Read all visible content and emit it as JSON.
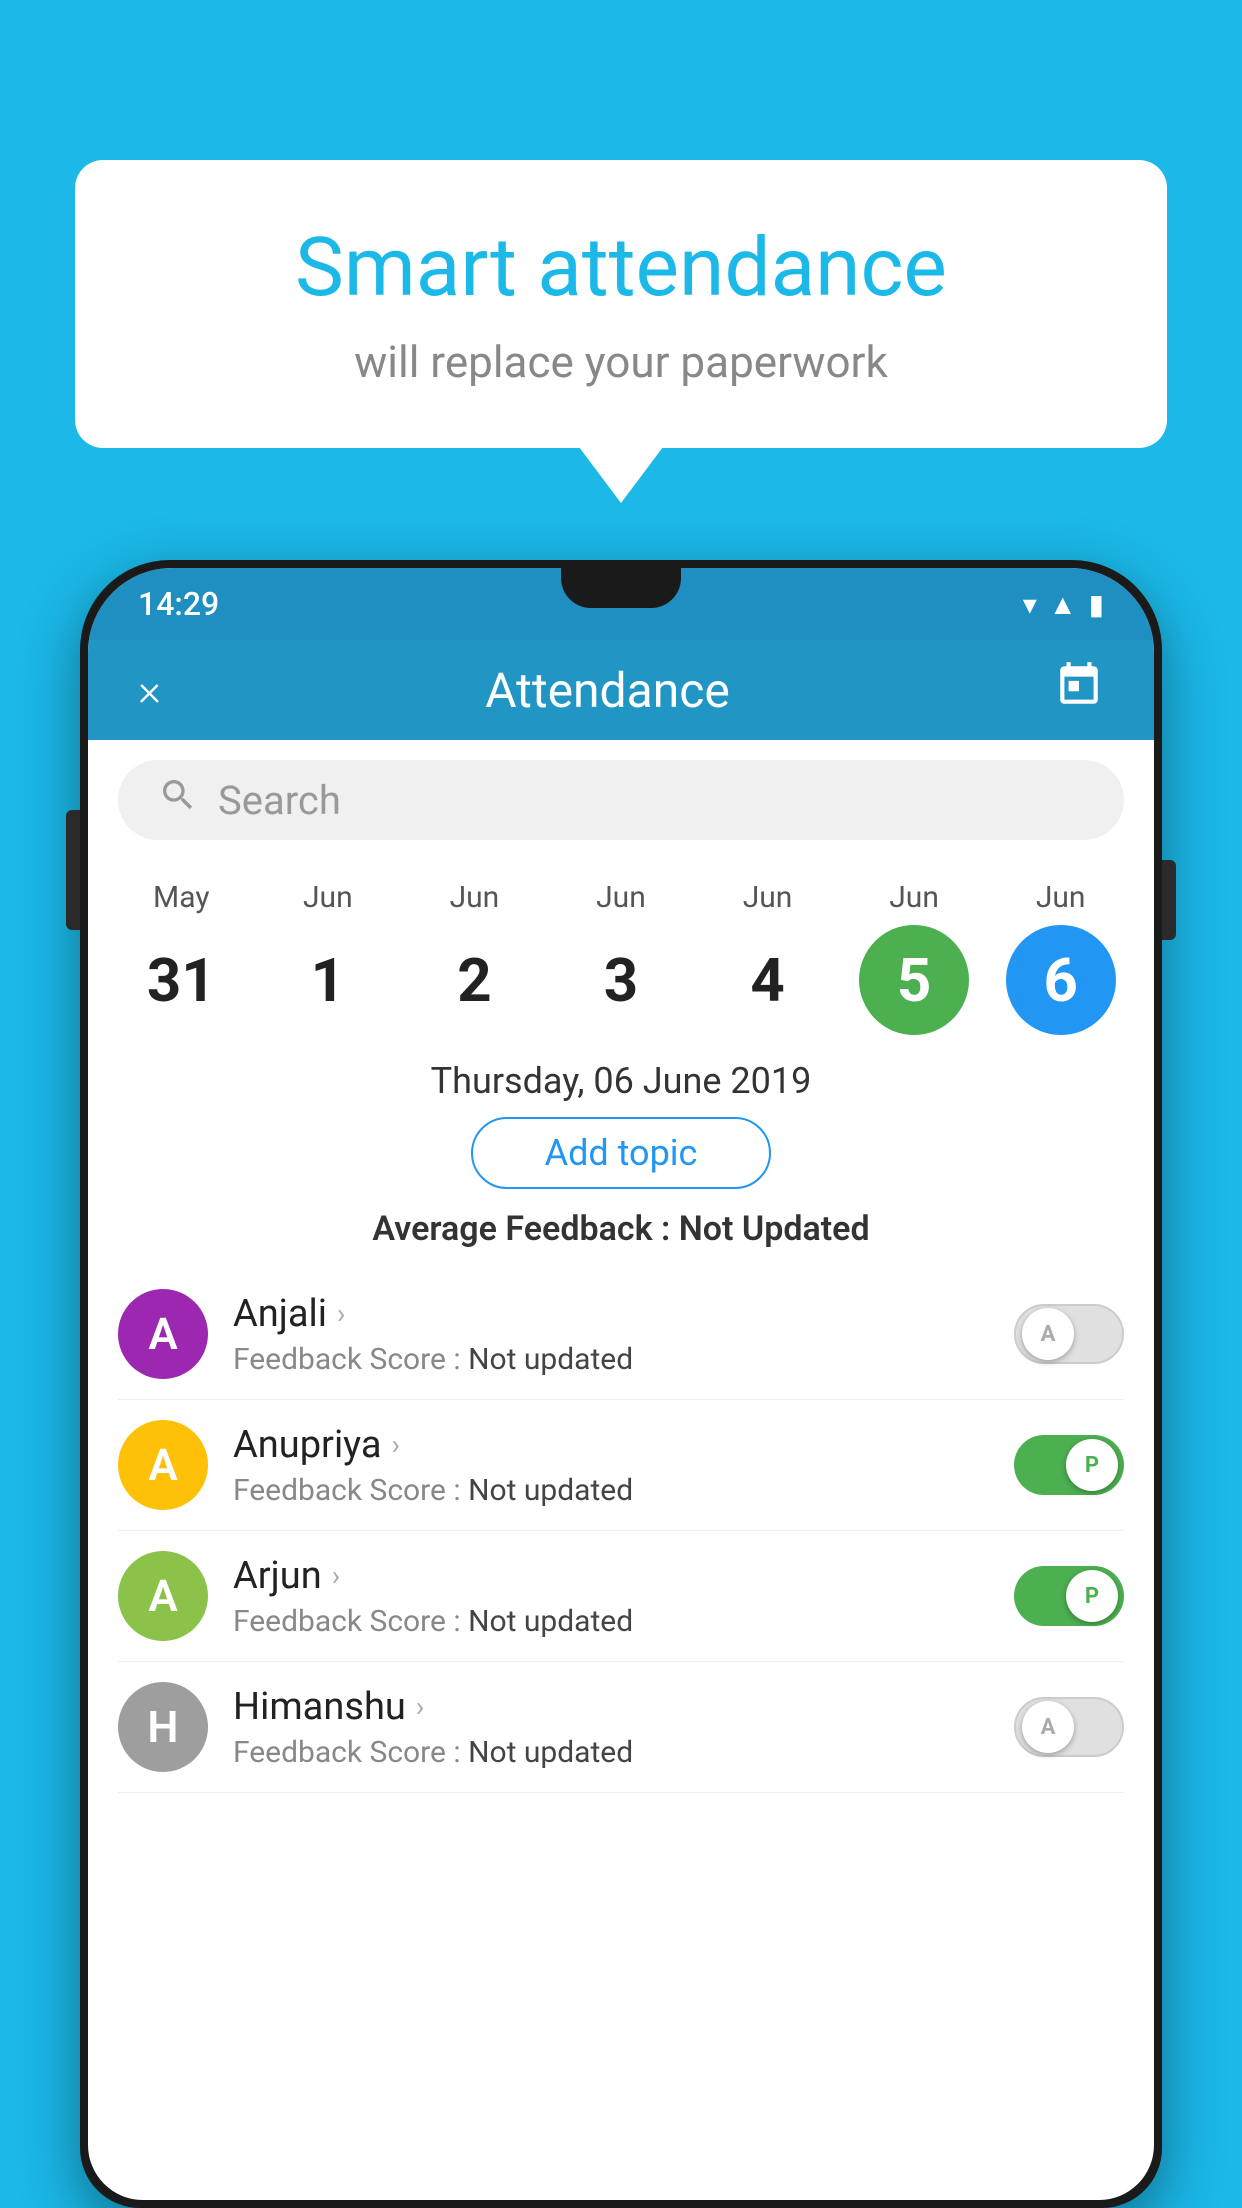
{
  "background_color": "#1bb8e8",
  "speech_bubble": {
    "title": "Smart attendance",
    "subtitle": "will replace your paperwork"
  },
  "status_bar": {
    "time": "14:29"
  },
  "app_header": {
    "title": "Attendance",
    "close_label": "×",
    "calendar_icon": "📅"
  },
  "search": {
    "placeholder": "Search"
  },
  "calendar": {
    "days": [
      {
        "month": "May",
        "date": "31",
        "style": "normal"
      },
      {
        "month": "Jun",
        "date": "1",
        "style": "normal"
      },
      {
        "month": "Jun",
        "date": "2",
        "style": "normal"
      },
      {
        "month": "Jun",
        "date": "3",
        "style": "normal"
      },
      {
        "month": "Jun",
        "date": "4",
        "style": "normal"
      },
      {
        "month": "Jun",
        "date": "5",
        "style": "today"
      },
      {
        "month": "Jun",
        "date": "6",
        "style": "selected"
      }
    ]
  },
  "selected_date": "Thursday, 06 June 2019",
  "add_topic_label": "Add topic",
  "avg_feedback_label": "Average Feedback : ",
  "avg_feedback_value": "Not Updated",
  "students": [
    {
      "name": "Anjali",
      "avatar_letter": "A",
      "avatar_color": "#9c27b0",
      "feedback_label": "Feedback Score : ",
      "feedback_value": "Not updated",
      "toggle_state": "off",
      "toggle_letter": "A"
    },
    {
      "name": "Anupriya",
      "avatar_letter": "A",
      "avatar_color": "#ffc107",
      "feedback_label": "Feedback Score : ",
      "feedback_value": "Not updated",
      "toggle_state": "on",
      "toggle_letter": "P"
    },
    {
      "name": "Arjun",
      "avatar_letter": "A",
      "avatar_color": "#8bc34a",
      "feedback_label": "Feedback Score : ",
      "feedback_value": "Not updated",
      "toggle_state": "on",
      "toggle_letter": "P"
    },
    {
      "name": "Himanshu",
      "avatar_letter": "H",
      "avatar_color": "#9e9e9e",
      "feedback_label": "Feedback Score : ",
      "feedback_value": "Not updated",
      "toggle_state": "off",
      "toggle_letter": "A"
    }
  ]
}
